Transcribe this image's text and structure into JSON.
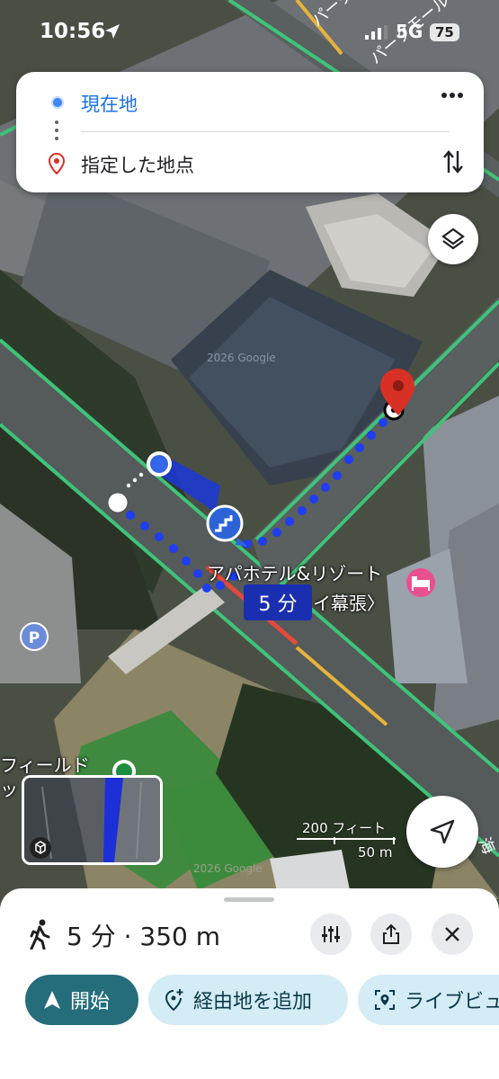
{
  "status_bar": {
    "time": "10:56",
    "network": "5G",
    "battery": "75"
  },
  "directions": {
    "origin": "現在地",
    "destination": "指定した地点"
  },
  "map": {
    "road_labels": [
      "パーク",
      "パークモール"
    ],
    "poi_hotel": "アパホテル&リゾート",
    "poi_hotel_line2": "イ幕張〉",
    "poi_field": "フィールド",
    "poi_field_line2": "ット",
    "duration_chip": "5 分",
    "parking_label": "P",
    "watermark": "2026 Google",
    "scale_feet": "200 フィート",
    "scale_m": "50 m",
    "edge_label": "海"
  },
  "sheet": {
    "summary": "5 分 · 350 m",
    "chips": {
      "start": "開始",
      "add_stop": "経由地を追加",
      "live_view": "ライブビュ"
    }
  },
  "colors": {
    "route_dots": "#1e3ef0",
    "accent_blue": "#1a73e8",
    "pin_red": "#d93025",
    "start_chip": "#256d7b",
    "secondary_chip": "#d3ecf5"
  },
  "icons": [
    "location-arrow-icon",
    "signal-icon",
    "more-icon",
    "swap-icon",
    "pin-icon",
    "layers-icon",
    "stairs-icon",
    "hotel-icon",
    "parking-icon",
    "cube-icon",
    "navigate-icon",
    "walk-icon",
    "tune-icon",
    "share-icon",
    "close-icon",
    "navigation-arrow-icon",
    "add-location-icon",
    "live-view-icon"
  ]
}
